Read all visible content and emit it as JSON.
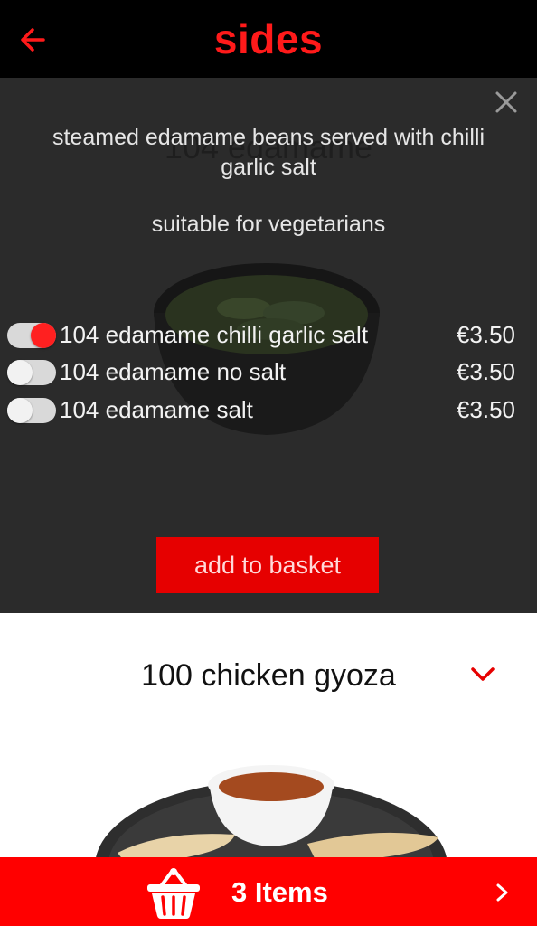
{
  "header": {
    "title": "sides",
    "back_icon": "back-arrow-icon"
  },
  "expanded_item": {
    "ghost_title": "104 edamame",
    "description": "steamed edamame beans served with chilli garlic salt",
    "dietary": "suitable for vegetarians",
    "options": [
      {
        "name": "104 edamame chilli garlic salt",
        "price": "€3.50",
        "selected": true
      },
      {
        "name": "104 edamame no salt",
        "price": "€3.50",
        "selected": false
      },
      {
        "name": "104 edamame salt",
        "price": "€3.50",
        "selected": false
      }
    ],
    "add_button_label": "add to basket"
  },
  "next_item": {
    "title": "100 chicken gyoza"
  },
  "basket": {
    "label": "3 Items",
    "icon": "basket-icon"
  },
  "colors": {
    "brand_red": "#ff0000",
    "header_bg": "#000000",
    "overlay_bg": "#2b2b2b"
  }
}
